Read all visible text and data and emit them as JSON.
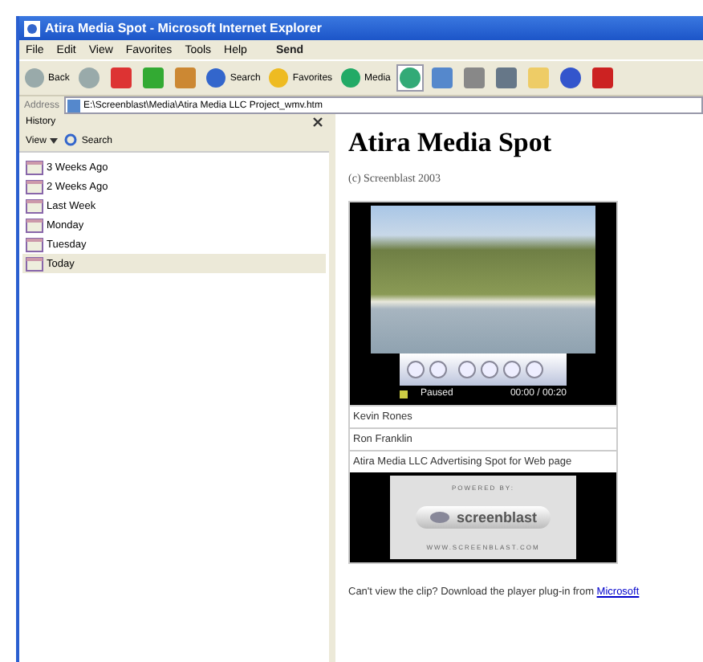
{
  "window": {
    "title": "Atira Media Spot - Microsoft Internet Explorer"
  },
  "menu": [
    "File",
    "Edit",
    "View",
    "Favorites",
    "Tools",
    "Help"
  ],
  "menu_send": "Send",
  "toolbar": [
    {
      "kind": "back",
      "label": "Back"
    },
    {
      "kind": "forward"
    },
    {
      "kind": "stop"
    },
    {
      "kind": "refresh"
    },
    {
      "kind": "home"
    },
    {
      "kind": "search",
      "label": "Search"
    },
    {
      "kind": "favorites",
      "label": "Favorites"
    },
    {
      "kind": "media",
      "label": "Media"
    },
    {
      "kind": "history",
      "selected": true
    },
    {
      "kind": "mail"
    },
    {
      "kind": "print"
    },
    {
      "kind": "edit"
    },
    {
      "kind": "note"
    },
    {
      "kind": "messenger"
    },
    {
      "kind": "y"
    }
  ],
  "address": {
    "label": "Address",
    "value": "E:\\Screenblast\\Media\\Atira Media LLC Project_wmv.htm"
  },
  "sidebar": {
    "title": "History",
    "view": "View",
    "search": "Search",
    "items": [
      {
        "label": "3 Weeks Ago",
        "selected": false
      },
      {
        "label": "2 Weeks Ago",
        "selected": false
      },
      {
        "label": "Last Week",
        "selected": false
      },
      {
        "label": "Monday",
        "selected": false
      },
      {
        "label": "Tuesday",
        "selected": false
      },
      {
        "label": "Today",
        "selected": true
      }
    ]
  },
  "page": {
    "heading": "Atira Media Spot",
    "copyright": "(c) Screenblast 2003",
    "player": {
      "status": "Paused",
      "time": "00:00 / 00:20"
    },
    "rows": [
      "Kevin Rones",
      "Ron Franklin",
      "Atira Media LLC Advertising Spot for Web page"
    ],
    "banner": {
      "top": "POWERED BY:",
      "logo": "screenblast",
      "url": "WWW.SCREENBLAST.COM"
    },
    "footer": "Can't view the clip? Download the player plug-in from",
    "footer_link": "Microsoft"
  }
}
